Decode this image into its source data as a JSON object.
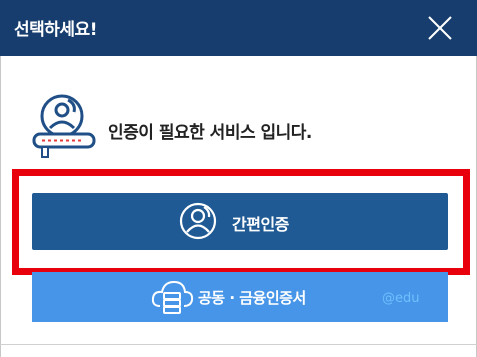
{
  "dialog": {
    "title": "선택하세요!",
    "close_icon": "close-icon"
  },
  "info": {
    "icon": "user-id-card-icon",
    "message": "인증이 필요한 서비스 입니다."
  },
  "buttons": {
    "simple_auth": {
      "label": "간편인증",
      "icon": "user-circle-icon"
    },
    "certificate": {
      "label": "공동 · 금융인증서",
      "icon": "cloud-server-icon"
    }
  },
  "watermark": {
    "text": "@edu"
  },
  "colors": {
    "titlebar": "#163d6d",
    "primary_button": "#1f5a94",
    "secondary_button": "#4695e8",
    "highlight": "#e8000c"
  }
}
